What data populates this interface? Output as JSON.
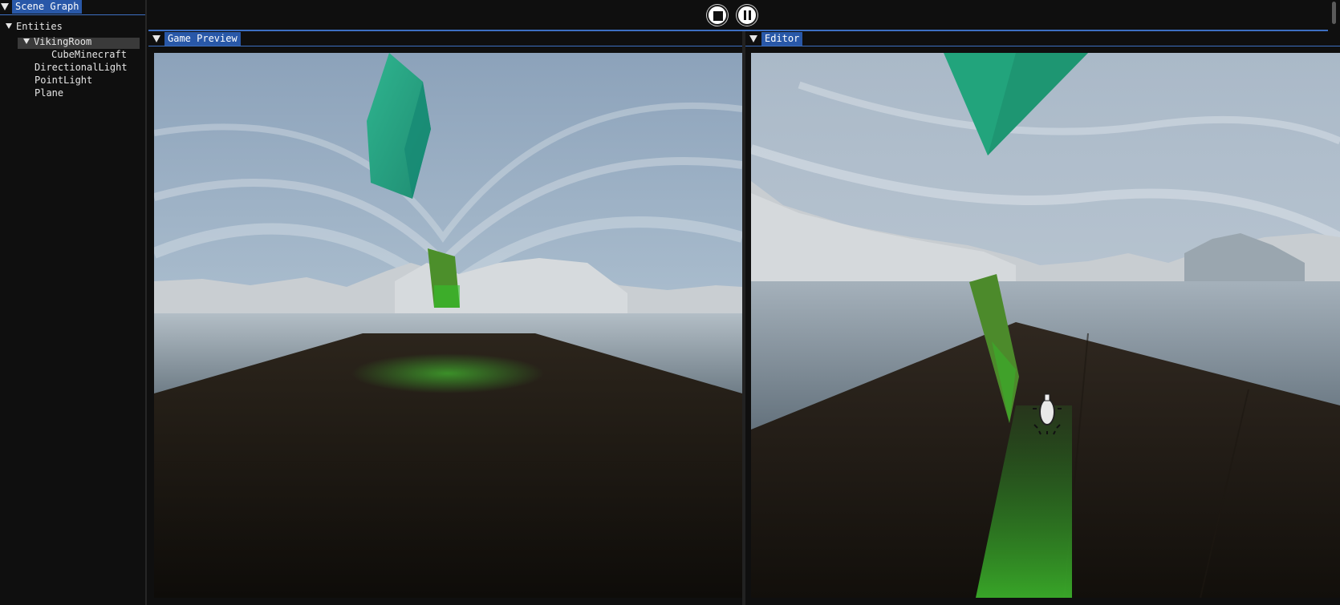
{
  "scene_graph": {
    "title": "Scene Graph",
    "root": "Entities",
    "items": [
      {
        "label": "VikingRoom",
        "expanded": true,
        "selected": true
      },
      {
        "label": "CubeMinecraft"
      },
      {
        "label": "DirectionalLight"
      },
      {
        "label": "PointLight"
      },
      {
        "label": "Plane"
      }
    ]
  },
  "toolbar": {
    "stop_icon": "stop-icon",
    "pause_icon": "pause-icon"
  },
  "game_preview": {
    "title": "Game Preview"
  },
  "editor": {
    "title": "Editor"
  },
  "colors": {
    "header_accent": "#2958a8",
    "border_accent": "#3d6fc2",
    "background": "#0f0f0f",
    "selection": "#3a3a3a"
  }
}
